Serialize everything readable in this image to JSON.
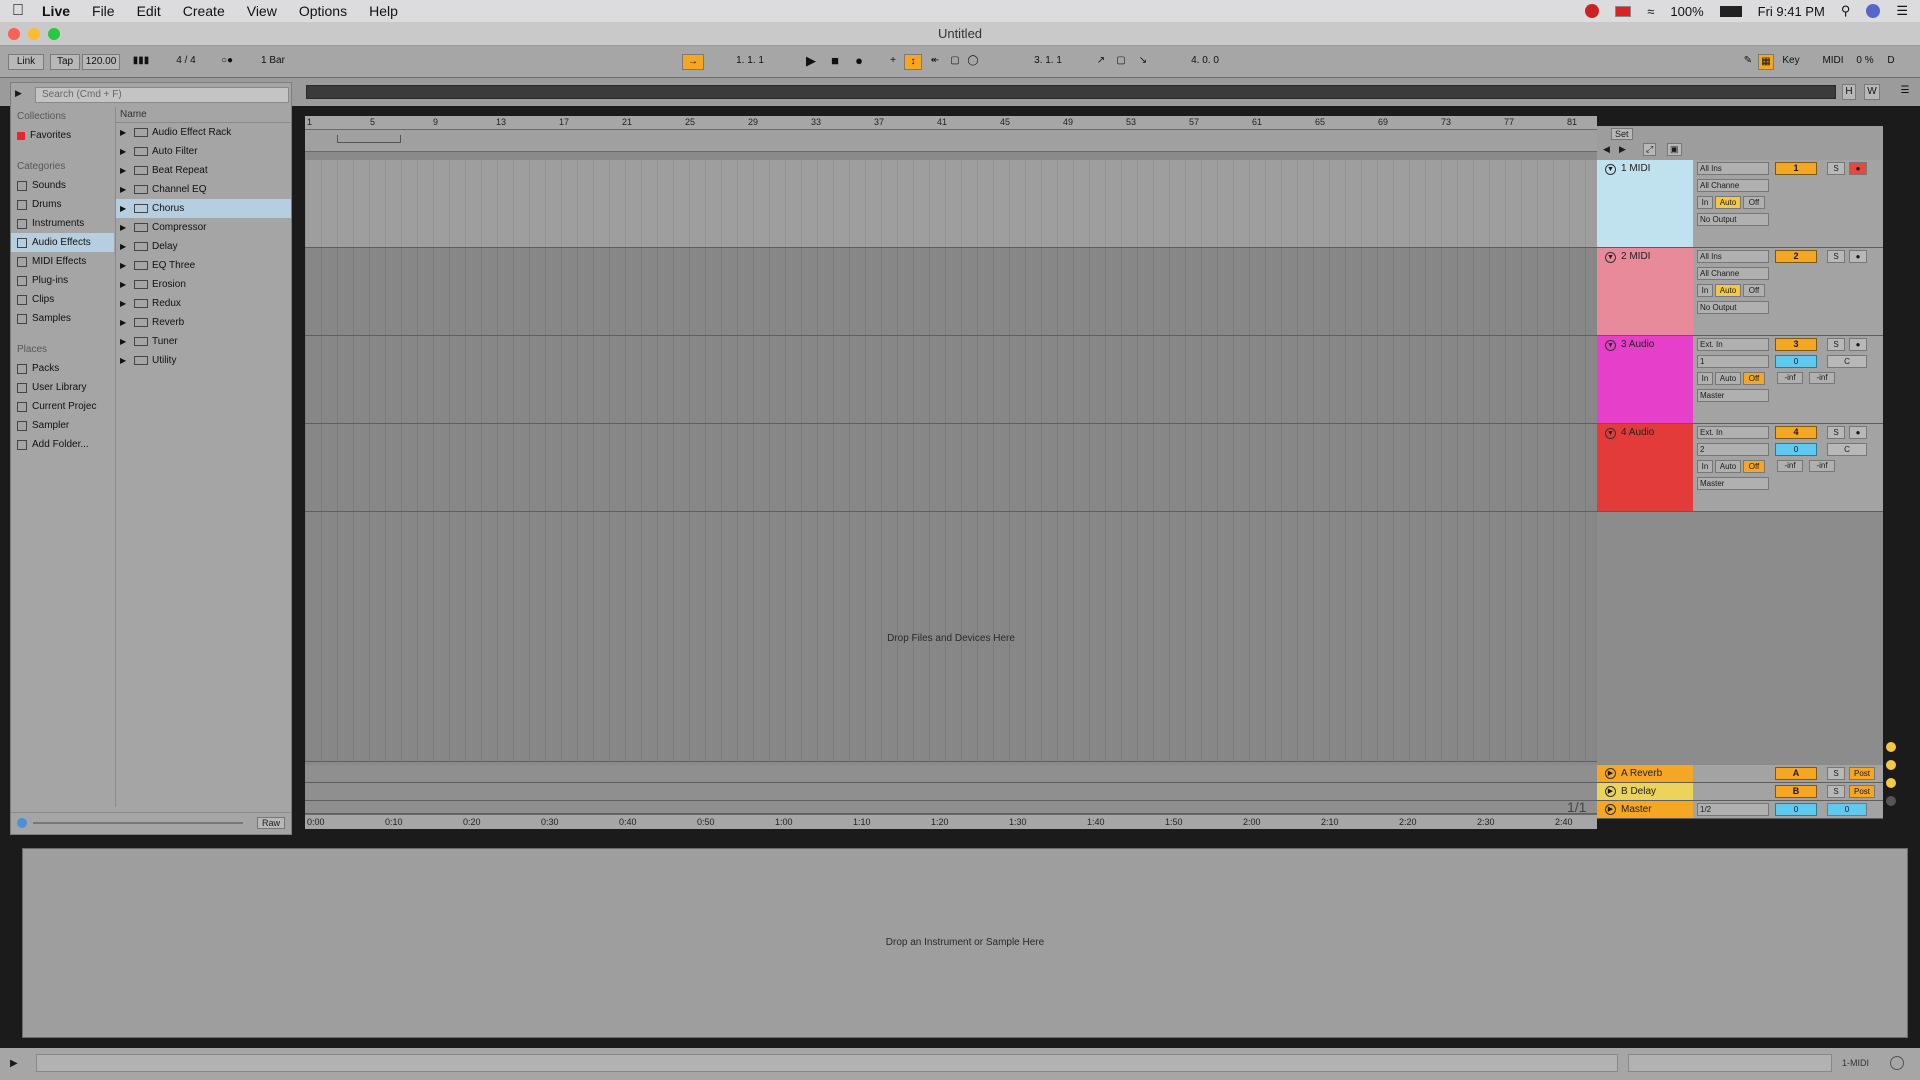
{
  "menubar": {
    "app": "Live",
    "items": [
      "File",
      "Edit",
      "Create",
      "View",
      "Options",
      "Help"
    ],
    "battery": "100%",
    "clock": "Fri 9:41 PM"
  },
  "window": {
    "title": "Untitled"
  },
  "controlbar": {
    "link": "Link",
    "tap": "Tap",
    "tempo": "120.00",
    "signature": "4 / 4",
    "quantize": "1 Bar",
    "position": "1.   1.   1",
    "loop_start": "3.   1.   1",
    "loop_length": "4.   0.   0",
    "key": "Key",
    "midi": "MIDI",
    "cpu": "0 %",
    "disk": "D"
  },
  "browser": {
    "search_placeholder": "Search (Cmd + F)",
    "collections_heading": "Collections",
    "favorites": "Favorites",
    "categories_heading": "Categories",
    "categories": [
      "Sounds",
      "Drums",
      "Instruments",
      "Audio Effects",
      "MIDI Effects",
      "Plug-ins",
      "Clips",
      "Samples"
    ],
    "selected_category": "Audio Effects",
    "places_heading": "Places",
    "places": [
      "Packs",
      "User Library",
      "Current Projec",
      "Sampler",
      "Add Folder..."
    ],
    "name_heading": "Name",
    "items": [
      "Audio Effect Rack",
      "Auto Filter",
      "Beat Repeat",
      "Channel EQ",
      "Chorus",
      "Compressor",
      "Delay",
      "EQ Three",
      "Erosion",
      "Redux",
      "Reverb",
      "Tuner",
      "Utility"
    ],
    "selected_item": "Chorus",
    "raw": "Raw"
  },
  "arrangement": {
    "bar_ticks": [
      "1",
      "5",
      "9",
      "13",
      "17",
      "21",
      "25",
      "29",
      "33",
      "37",
      "41",
      "45",
      "49",
      "53",
      "57",
      "61",
      "65",
      "69",
      "73",
      "77",
      "81"
    ],
    "time_ticks": [
      "0:00",
      "0:10",
      "0:20",
      "0:30",
      "0:40",
      "0:50",
      "1:00",
      "1:10",
      "1:20",
      "1:30",
      "1:40",
      "1:50",
      "2:00",
      "2:10",
      "2:20",
      "2:30",
      "2:40"
    ],
    "drop_text": "Drop Files and Devices Here",
    "zoom_ratio": "1/1",
    "set_label": "Set"
  },
  "tracks": [
    {
      "name": "1 MIDI",
      "color": "#bfe2ee",
      "input": "All Ins",
      "channel": "All Channe",
      "monitor": [
        "In",
        "Auto",
        "Off"
      ],
      "output": "No Output",
      "number": "1",
      "solo": "S",
      "armed": true
    },
    {
      "name": "2 MIDI",
      "color": "#e88a9a",
      "input": "All Ins",
      "channel": "All Channe",
      "monitor": [
        "In",
        "Auto",
        "Off"
      ],
      "output": "No Output",
      "number": "2",
      "solo": "S",
      "armed": false
    },
    {
      "name": "3 Audio",
      "color": "#e63fc9",
      "input": "Ext. In",
      "channel": "1",
      "monitor": [
        "In",
        "Auto",
        "Off"
      ],
      "output": "Master",
      "number": "3",
      "solo": "S",
      "armed": false,
      "volume": "0",
      "pan": "C",
      "peak": [
        "-inf",
        "-inf"
      ]
    },
    {
      "name": "4 Audio",
      "color": "#e33a3a",
      "input": "Ext. In",
      "channel": "2",
      "monitor": [
        "In",
        "Auto",
        "Off"
      ],
      "output": "Master",
      "number": "4",
      "solo": "S",
      "armed": false,
      "volume": "0",
      "pan": "C",
      "peak": [
        "-inf",
        "-inf"
      ]
    }
  ],
  "returns": [
    {
      "name": "A Reverb",
      "send": "A",
      "solo": "S",
      "mode": "Post"
    },
    {
      "name": "B Delay",
      "send": "B",
      "solo": "S",
      "mode": "Post"
    }
  ],
  "master": {
    "name": "Master",
    "cue": "1/2",
    "volume": "0",
    "pan": "0"
  },
  "detail": {
    "drop_text": "Drop an Instrument or Sample Here"
  },
  "statusbar": {
    "selected_track": "1-MIDI"
  }
}
